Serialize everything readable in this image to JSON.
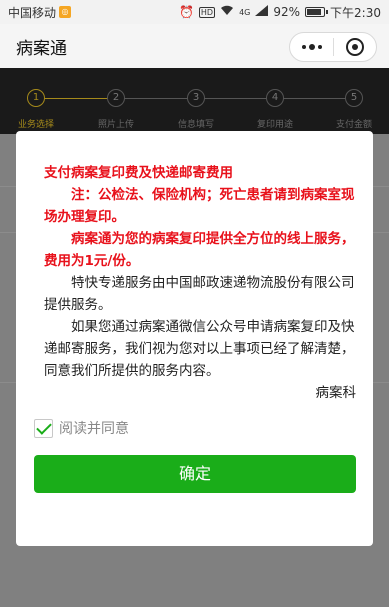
{
  "status_bar": {
    "carrier": "中国移动",
    "network": "4G",
    "battery": "92%",
    "battery_level": 0.92,
    "time": "下午2:30"
  },
  "nav": {
    "title": "病案通"
  },
  "steps": [
    {
      "num": "1",
      "label": "业务选择"
    },
    {
      "num": "2",
      "label": "照片上传"
    },
    {
      "num": "3",
      "label": "信息填写"
    },
    {
      "num": "4",
      "label": "复印用途"
    },
    {
      "num": "5",
      "label": "支付金额"
    }
  ],
  "modal": {
    "title": "支付病案复印费及快递邮寄费用",
    "note": "注：公检法、保险机构；死亡患者请到病案室现场办理复印。",
    "service": "病案通为您的病案复印提供全方位的线上服务，费用为1元/份。",
    "express": "特快专递服务由中国邮政速递物流股份有限公司提供服务。",
    "agreement": "如果您通过病案通微信公众号申请病案复印及快递邮寄服务，我们视为您对以上事项已经了解清楚，同意我们所提供的服务内容。",
    "signature": "病案科",
    "agree_label": "阅读并同意",
    "confirm_label": "确定"
  },
  "colors": {
    "accent_green": "#1aad19",
    "alert_red": "#e8111b",
    "step_active": "#a58a1b"
  }
}
